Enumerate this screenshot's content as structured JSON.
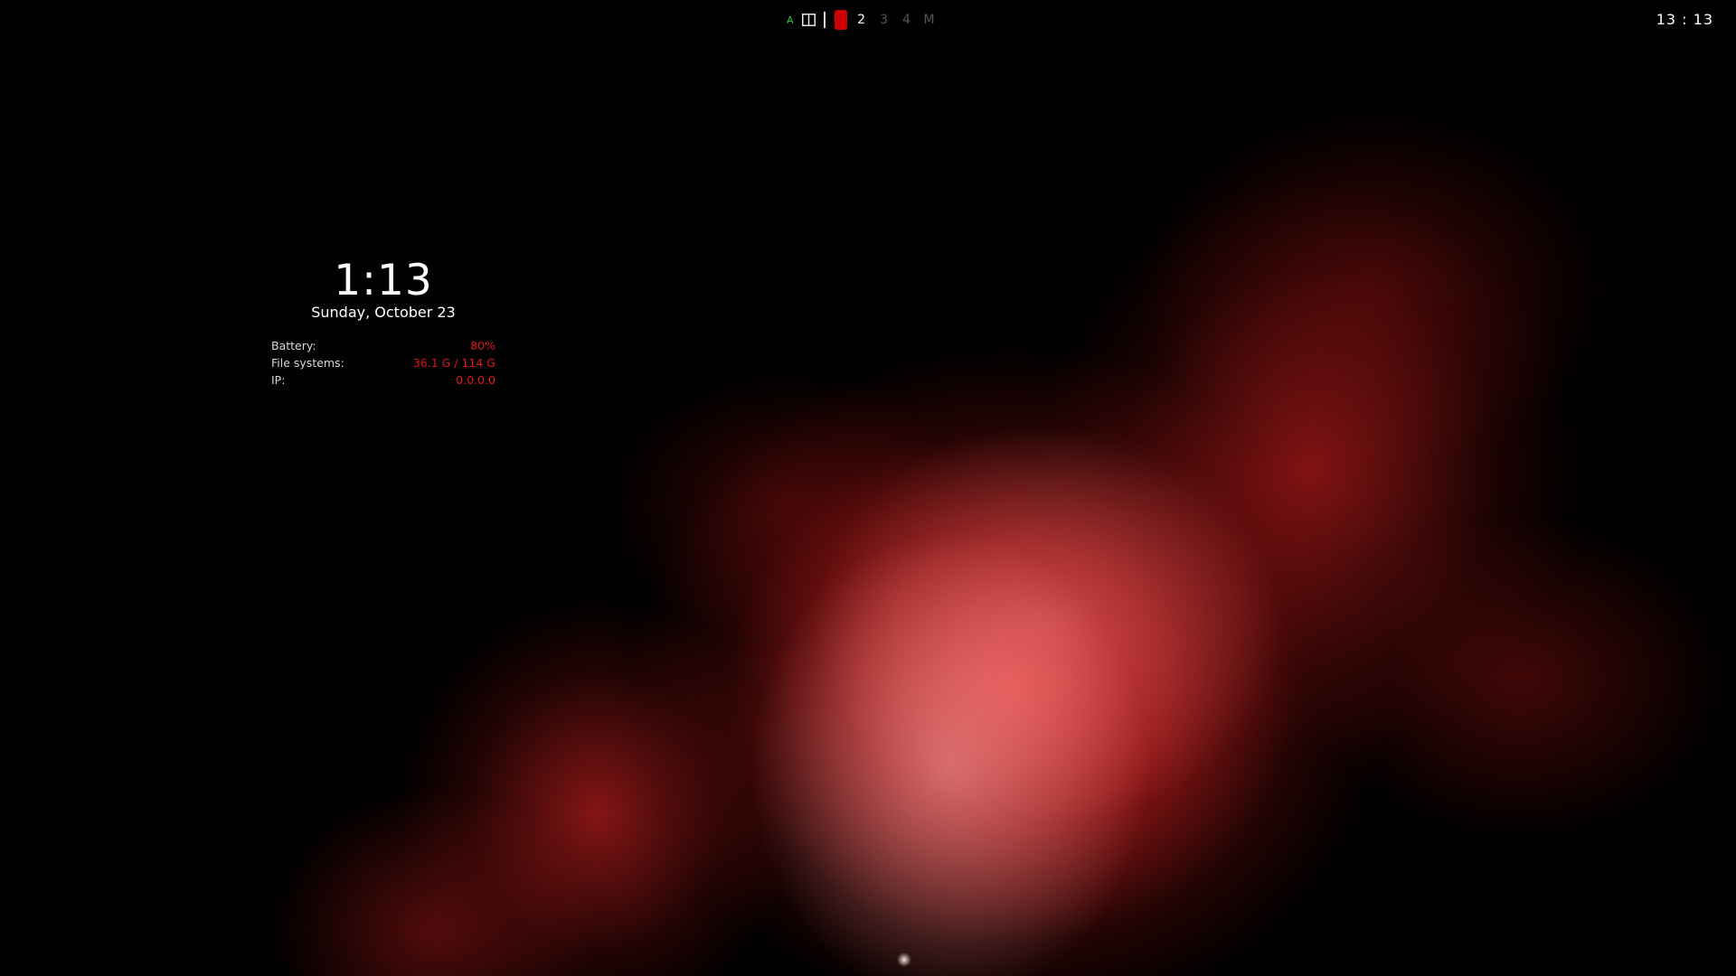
{
  "colors": {
    "accent": "#cc0000",
    "mode_indicator": "#2ecc40",
    "value_text": "#e0141a",
    "inactive_workspace": "#555555"
  },
  "topbar": {
    "mode_letter": "A",
    "layout_icon": "split-columns-icon",
    "workspaces": [
      {
        "label": "2",
        "state": "occupied"
      },
      {
        "label": "3",
        "state": "empty"
      },
      {
        "label": "4",
        "state": "empty"
      },
      {
        "label": "M",
        "state": "empty"
      }
    ],
    "active_workspace_icon": "active-workspace-indicator",
    "clock": "13 : 13"
  },
  "widget": {
    "time": "1:13",
    "date": "Sunday, October 23",
    "stats": [
      {
        "label": "Battery:",
        "value": "80%"
      },
      {
        "label": "File systems:",
        "value": "36.1 G / 114 G"
      },
      {
        "label": "IP:",
        "value": "0.0.0.0"
      }
    ]
  }
}
